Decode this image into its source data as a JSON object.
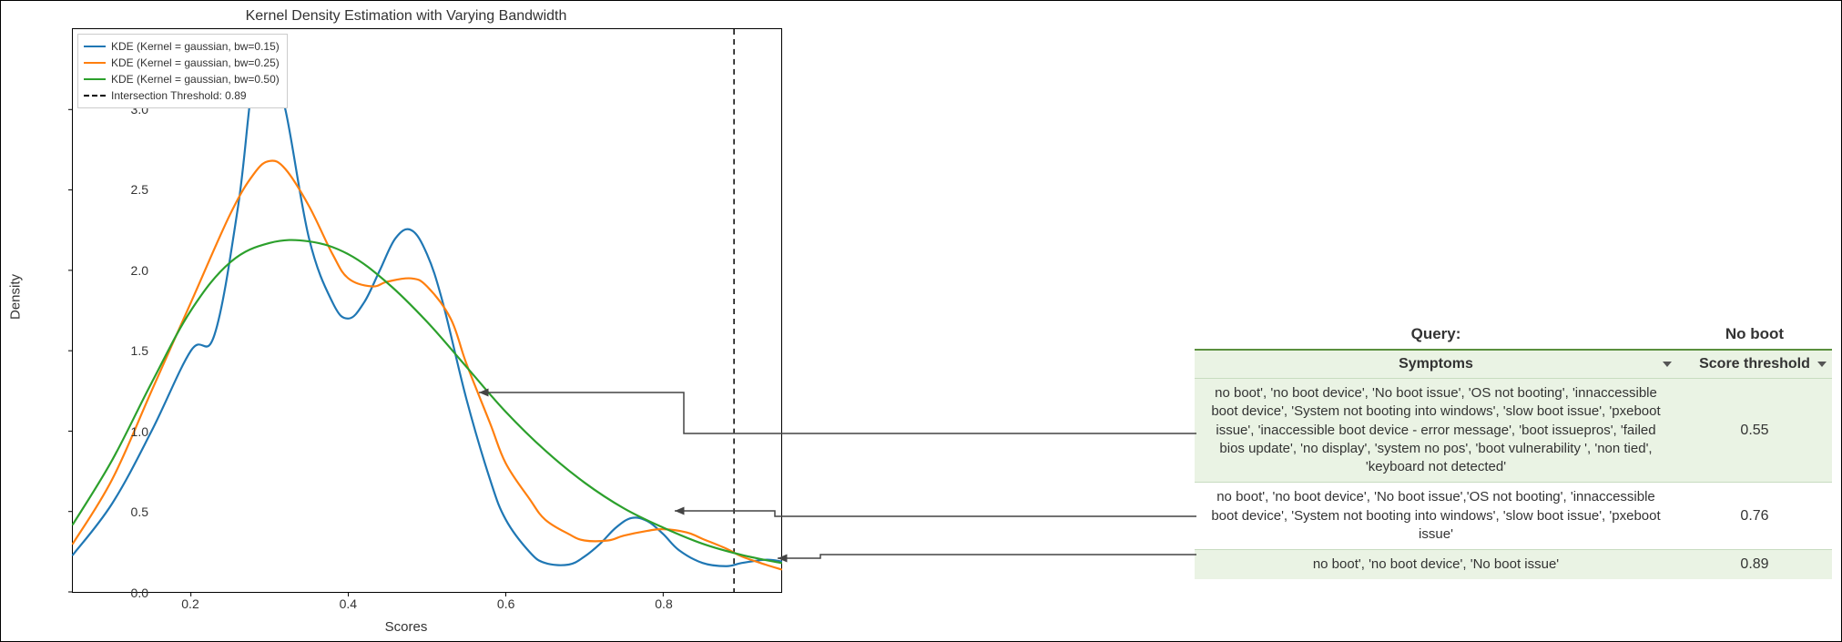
{
  "chart_data": {
    "type": "line",
    "title": "Kernel Density Estimation with Varying Bandwidth",
    "xlabel": "Scores",
    "ylabel": "Density",
    "xlim": [
      0.05,
      0.95
    ],
    "ylim": [
      0.0,
      3.5
    ],
    "x_ticks": [
      0.2,
      0.4,
      0.6,
      0.8
    ],
    "y_ticks": [
      0.0,
      0.5,
      1.0,
      1.5,
      2.0,
      2.5,
      3.0
    ],
    "threshold_x": 0.89,
    "legend": [
      {
        "label": "KDE (Kernel = gaussian, bw=0.15)",
        "color": "#1f77b4",
        "style": "solid"
      },
      {
        "label": "KDE (Kernel = gaussian, bw=0.25)",
        "color": "#ff7f0e",
        "style": "solid"
      },
      {
        "label": "KDE (Kernel = gaussian, bw=0.50)",
        "color": "#2ca02c",
        "style": "solid"
      },
      {
        "label": "Intersection Threshold: 0.89",
        "color": "#000000",
        "style": "dashed"
      }
    ],
    "series": [
      {
        "name": "bw=0.15",
        "color": "#1f77b4",
        "x": [
          0.05,
          0.1,
          0.15,
          0.2,
          0.23,
          0.26,
          0.28,
          0.3,
          0.32,
          0.35,
          0.38,
          0.4,
          0.42,
          0.44,
          0.46,
          0.48,
          0.5,
          0.52,
          0.55,
          0.58,
          0.6,
          0.63,
          0.65,
          0.68,
          0.7,
          0.72,
          0.74,
          0.76,
          0.78,
          0.8,
          0.82,
          0.85,
          0.88,
          0.9,
          0.93,
          0.95
        ],
        "y": [
          0.23,
          0.55,
          1.0,
          1.5,
          1.6,
          2.4,
          3.2,
          3.27,
          3.0,
          2.2,
          1.8,
          1.7,
          1.8,
          2.0,
          2.2,
          2.25,
          2.1,
          1.8,
          1.2,
          0.7,
          0.45,
          0.25,
          0.18,
          0.17,
          0.22,
          0.3,
          0.4,
          0.46,
          0.44,
          0.36,
          0.26,
          0.18,
          0.16,
          0.18,
          0.2,
          0.19
        ]
      },
      {
        "name": "bw=0.25",
        "color": "#ff7f0e",
        "x": [
          0.05,
          0.1,
          0.15,
          0.2,
          0.25,
          0.28,
          0.3,
          0.32,
          0.35,
          0.38,
          0.4,
          0.43,
          0.45,
          0.48,
          0.5,
          0.53,
          0.55,
          0.58,
          0.6,
          0.63,
          0.65,
          0.68,
          0.7,
          0.73,
          0.75,
          0.78,
          0.8,
          0.83,
          0.85,
          0.88,
          0.9,
          0.93,
          0.95
        ],
        "y": [
          0.3,
          0.7,
          1.25,
          1.8,
          2.35,
          2.6,
          2.68,
          2.63,
          2.4,
          2.1,
          1.95,
          1.9,
          1.93,
          1.95,
          1.9,
          1.7,
          1.42,
          1.05,
          0.8,
          0.58,
          0.45,
          0.36,
          0.32,
          0.32,
          0.35,
          0.38,
          0.39,
          0.37,
          0.33,
          0.27,
          0.22,
          0.17,
          0.14
        ]
      },
      {
        "name": "bw=0.50",
        "color": "#2ca02c",
        "x": [
          0.05,
          0.1,
          0.15,
          0.2,
          0.25,
          0.3,
          0.35,
          0.4,
          0.45,
          0.5,
          0.55,
          0.6,
          0.65,
          0.7,
          0.75,
          0.8,
          0.85,
          0.9,
          0.95
        ],
        "y": [
          0.42,
          0.82,
          1.3,
          1.75,
          2.05,
          2.17,
          2.18,
          2.1,
          1.92,
          1.68,
          1.4,
          1.12,
          0.88,
          0.68,
          0.52,
          0.4,
          0.3,
          0.23,
          0.18
        ]
      }
    ]
  },
  "table": {
    "query_header_left": "Query:",
    "query_header_right": "No boot",
    "sub_left": "Symptoms",
    "sub_right": "Score threshold",
    "rows": [
      {
        "symptoms": "no boot', 'no boot device', 'No boot issue', 'OS not booting', 'innaccessible boot device', 'System not booting into windows', 'slow boot issue', 'pxeboot issue', 'inaccessible boot device - error message', 'boot issuepros', 'failed bios update', 'no display', 'system no pos', 'boot vulnerability ', 'non tied', 'keyboard not detected'",
        "score": "0.55"
      },
      {
        "symptoms": "no boot', 'no boot device', 'No boot issue','OS not booting', 'innaccessible boot device', 'System not booting into windows', 'slow boot issue', 'pxeboot issue'",
        "score": "0.76"
      },
      {
        "symptoms": "no boot',  'no boot device', 'No boot issue'",
        "score": "0.89"
      }
    ]
  }
}
